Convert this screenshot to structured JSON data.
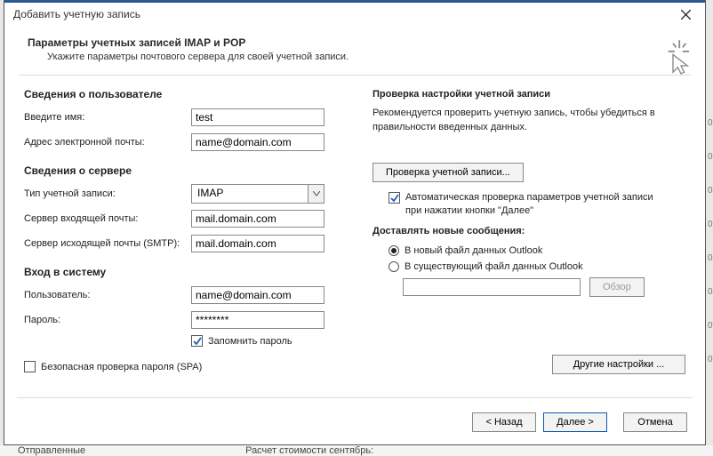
{
  "window": {
    "title": "Добавить учетную запись"
  },
  "header": {
    "title": "Параметры учетных записей IMAP и POP",
    "subtitle": "Укажите параметры почтового сервера для своей учетной записи."
  },
  "left": {
    "user_info_heading": "Сведения о пользователе",
    "name_label": "Введите имя:",
    "name_value": "test",
    "email_label": "Адрес электронной почты:",
    "email_value": "name@domain.com",
    "server_info_heading": "Сведения о сервере",
    "account_type_label": "Тип учетной записи:",
    "account_type_value": "IMAP",
    "incoming_label": "Сервер входящей почты:",
    "incoming_value": "mail.domain.com",
    "outgoing_label": "Сервер исходящей почты (SMTP):",
    "outgoing_value": "mail.domain.com",
    "login_heading": "Вход в систему",
    "user_label": "Пользователь:",
    "user_value": "name@domain.com",
    "password_label": "Пароль:",
    "password_value": "********",
    "remember_password": "Запомнить пароль",
    "spa_label": "Безопасная проверка пароля (SPA)"
  },
  "right": {
    "check_heading": "Проверка настройки учетной записи",
    "check_desc": "Рекомендуется проверить учетную запись, чтобы убедиться в правильности введенных данных.",
    "check_button": "Проверка учетной записи...",
    "auto_check_label": "Автоматическая проверка параметров учетной записи при нажатии кнопки \"Далее\"",
    "deliver_heading": "Доставлять новые сообщения:",
    "radio_new": "В новый файл данных Outlook",
    "radio_existing": "В существующий файл данных Outlook",
    "browse_button": "Обзор",
    "other_settings": "Другие настройки ..."
  },
  "footer": {
    "back": "< Назад",
    "next": "Далее >",
    "cancel": "Отмена"
  },
  "background": {
    "sent_folder": "Отправленные",
    "stub_text": "Расчет стоимости сентябрь:"
  }
}
